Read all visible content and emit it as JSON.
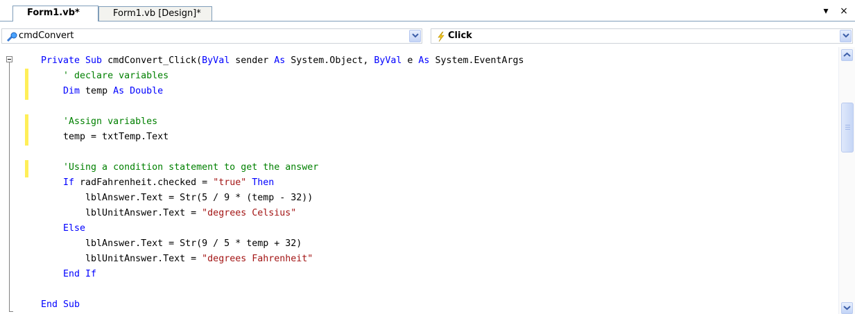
{
  "tabs": [
    {
      "label": "Form1.vb*",
      "active": true
    },
    {
      "label": "Form1.vb [Design]*",
      "active": false
    }
  ],
  "window_buttons": {
    "dropdown": "▾",
    "close": "×"
  },
  "navigation": {
    "class_combo": {
      "value": "cmdConvert",
      "icon": "control-icon"
    },
    "method_combo": {
      "value": "Click",
      "icon": "event-lightning-icon"
    }
  },
  "code_lines": [
    [
      {
        "t": "Private Sub ",
        "c": "kw"
      },
      {
        "t": "cmdConvert_Click(",
        "c": ""
      },
      {
        "t": "ByVal",
        "c": "kw"
      },
      {
        "t": " sender ",
        "c": ""
      },
      {
        "t": "As",
        "c": "kw"
      },
      {
        "t": " System.Object, ",
        "c": ""
      },
      {
        "t": "ByVal",
        "c": "kw"
      },
      {
        "t": " e ",
        "c": ""
      },
      {
        "t": "As",
        "c": "kw"
      },
      {
        "t": " System.EventArgs",
        "c": ""
      }
    ],
    [
      {
        "t": "    ' declare variables",
        "c": "cm"
      }
    ],
    [
      {
        "t": "    Dim",
        "c": "kw"
      },
      {
        "t": " temp ",
        "c": ""
      },
      {
        "t": "As Double",
        "c": "kw"
      }
    ],
    [],
    [
      {
        "t": "    'Assign variables",
        "c": "cm"
      }
    ],
    [
      {
        "t": "    temp = txtTemp.Text",
        "c": ""
      }
    ],
    [],
    [
      {
        "t": "    'Using a condition statement to get the answer",
        "c": "cm"
      }
    ],
    [
      {
        "t": "    If",
        "c": "kw"
      },
      {
        "t": " radFahrenheit.checked = ",
        "c": ""
      },
      {
        "t": "\"true\"",
        "c": "st"
      },
      {
        "t": " Then",
        "c": "kw"
      }
    ],
    [
      {
        "t": "        lblAnswer.Text = Str(5 / 9 * (temp - 32))",
        "c": ""
      }
    ],
    [
      {
        "t": "        lblUnitAnswer.Text = ",
        "c": ""
      },
      {
        "t": "\"degrees Celsius\"",
        "c": "st"
      }
    ],
    [
      {
        "t": "    Else",
        "c": "kw"
      }
    ],
    [
      {
        "t": "        lblAnswer.Text = Str(9 / 5 * temp + 32)",
        "c": ""
      }
    ],
    [
      {
        "t": "        lblUnitAnswer.Text = ",
        "c": ""
      },
      {
        "t": "\"degrees Fahrenheit\"",
        "c": "st"
      }
    ],
    [
      {
        "t": "    End If",
        "c": "kw"
      }
    ],
    [],
    [
      {
        "t": "End Sub",
        "c": "kw"
      }
    ]
  ],
  "colors": {
    "keyword": "#0000ff",
    "comment": "#008000",
    "string": "#a31515",
    "change_marker": "#ffef58"
  }
}
